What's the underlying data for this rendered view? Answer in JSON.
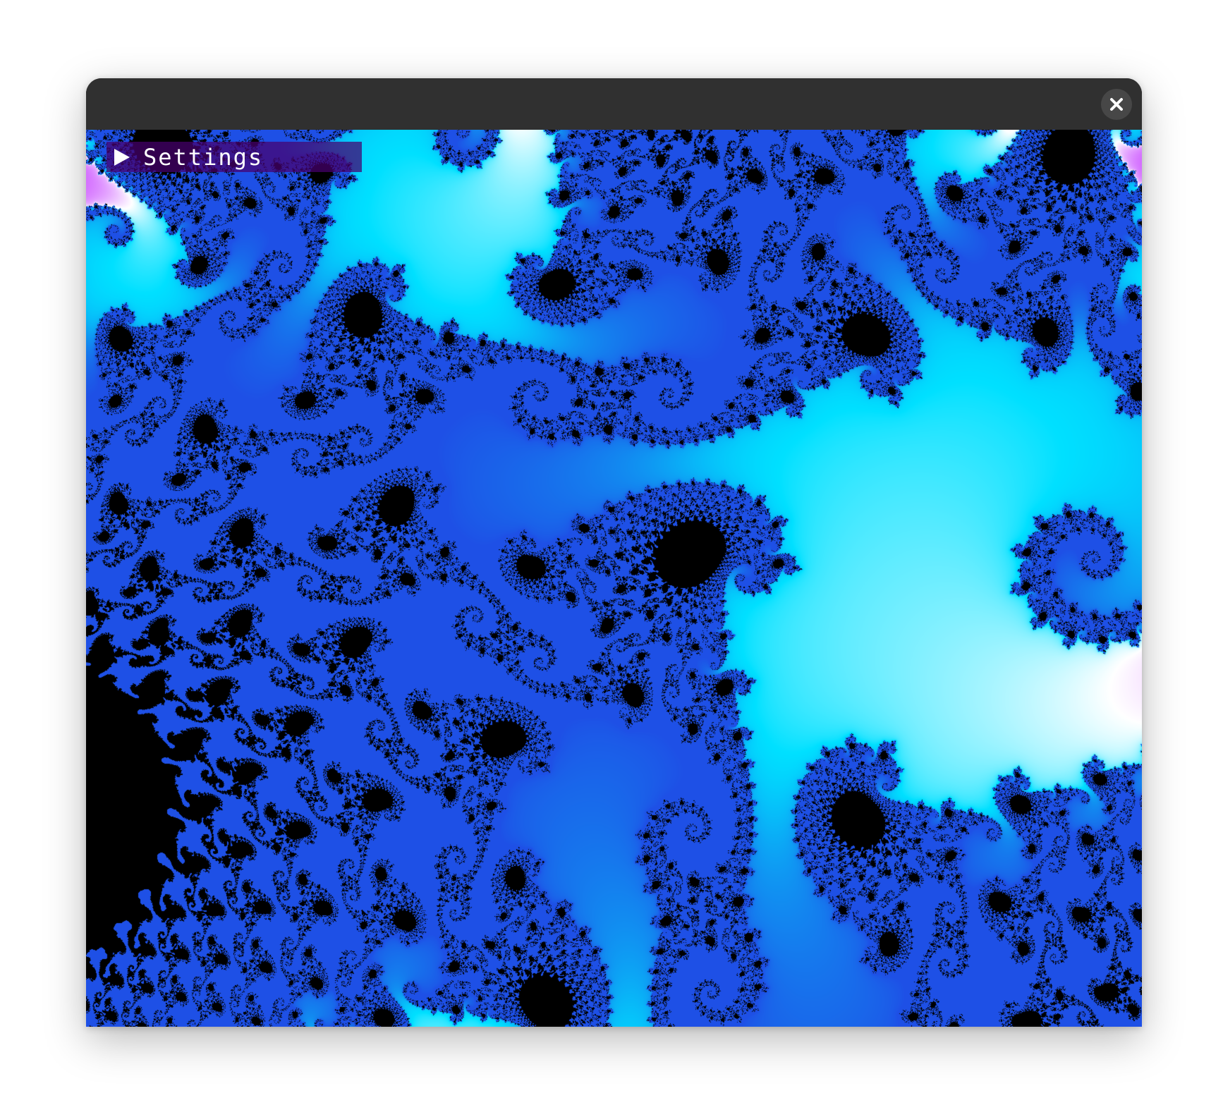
{
  "window": {
    "title": "",
    "close_icon": "close-icon"
  },
  "settings_panel": {
    "label": "Settings",
    "expanded": false,
    "arrow_icon": "triangle-right-icon"
  },
  "colors": {
    "titlebar": "#303030",
    "close_button": "#474747",
    "panel_header": "#46006e",
    "palette_outer_left": "#9000ff",
    "palette_outer_right": "#0040ff",
    "palette_mid": "#d36bff",
    "palette_near": "#ffffff",
    "palette_edge": "#00e0ff",
    "interior": "#000000"
  }
}
